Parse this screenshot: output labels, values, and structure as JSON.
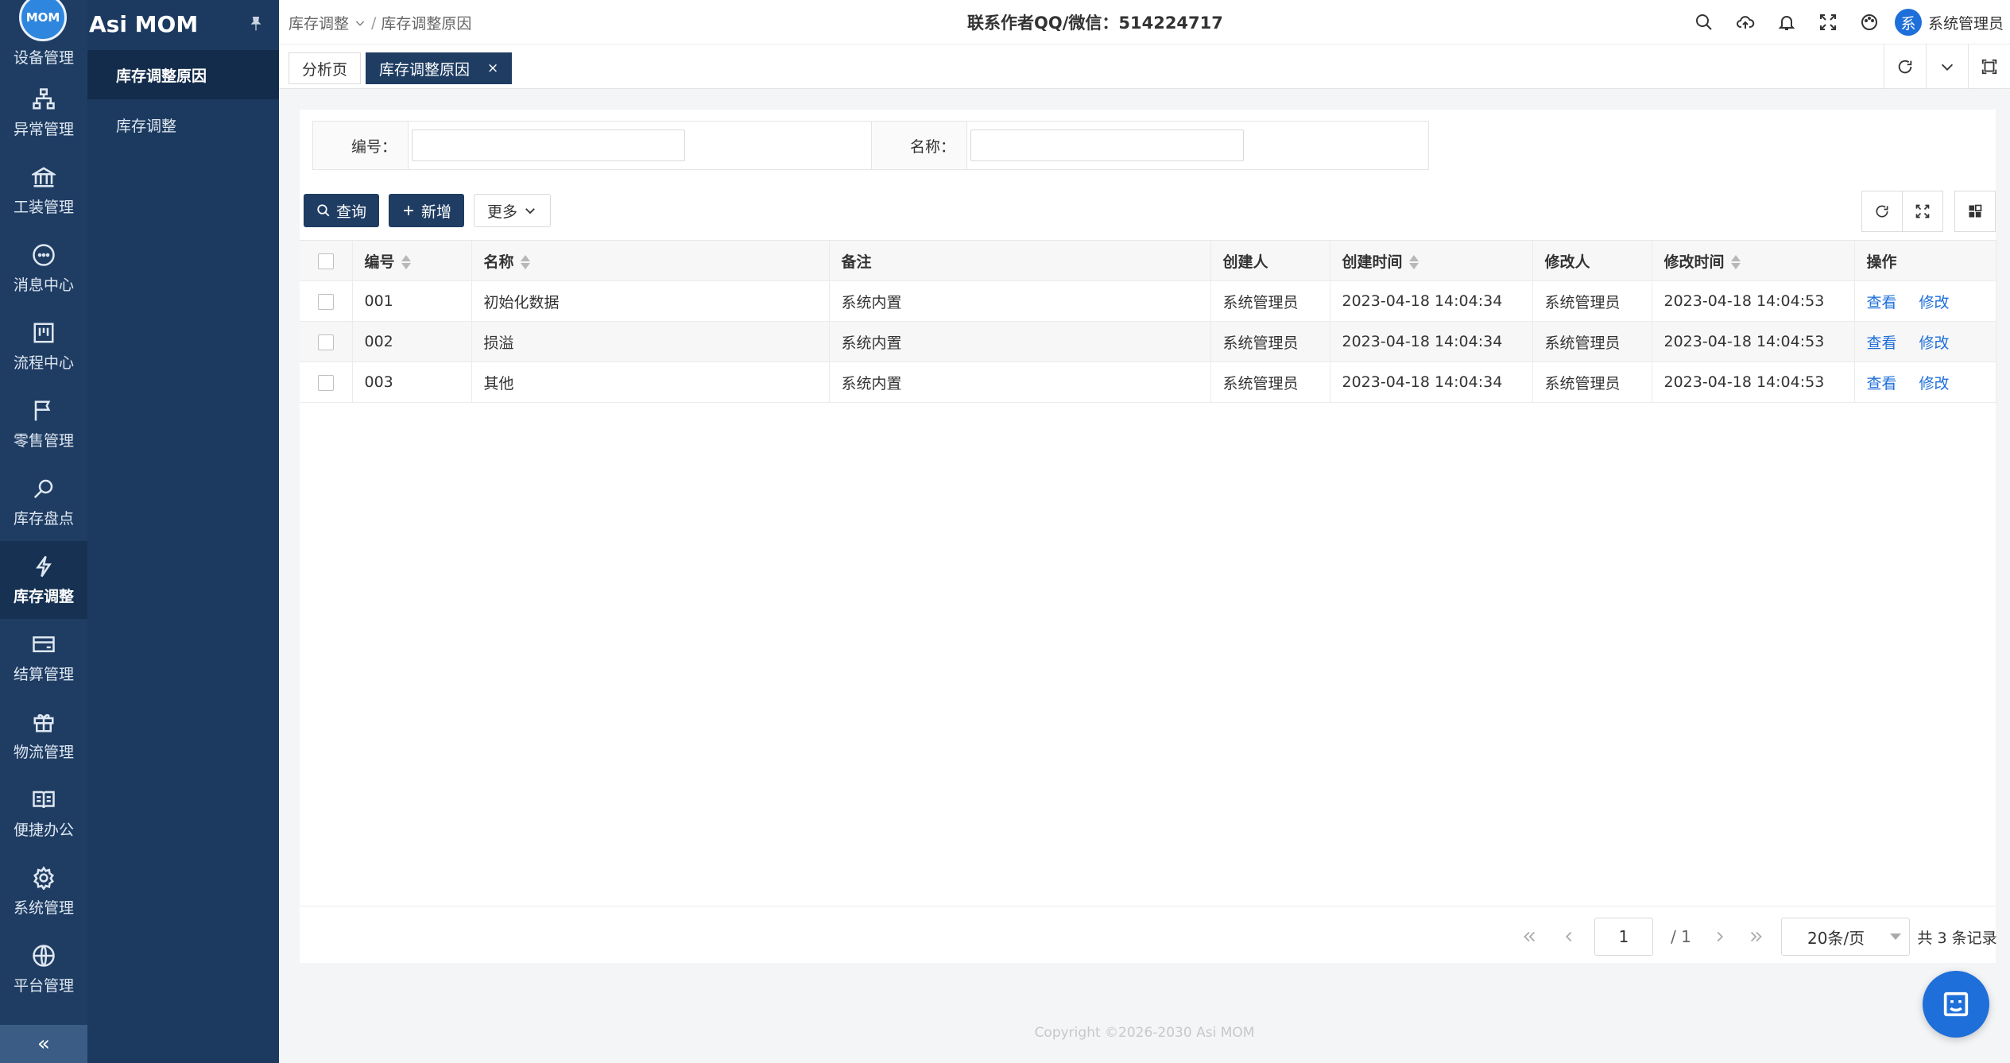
{
  "app": {
    "logo_text": "MOM",
    "name": "Asi MOM"
  },
  "rail": {
    "first_partial": "设备管理",
    "items": [
      {
        "label": "异常管理",
        "icon": "sitemap-icon"
      },
      {
        "label": "工装管理",
        "icon": "bank-icon"
      },
      {
        "label": "消息中心",
        "icon": "message-icon"
      },
      {
        "label": "流程中心",
        "icon": "board-icon"
      },
      {
        "label": "零售管理",
        "icon": "flag-icon"
      },
      {
        "label": "库存盘点",
        "icon": "search-doc-icon"
      },
      {
        "label": "库存调整",
        "icon": "bolt-icon",
        "active": true
      },
      {
        "label": "结算管理",
        "icon": "card-icon"
      },
      {
        "label": "物流管理",
        "icon": "gift-icon"
      },
      {
        "label": "便捷办公",
        "icon": "book-icon"
      },
      {
        "label": "系统管理",
        "icon": "gear-icon"
      },
      {
        "label": "平台管理",
        "icon": "globe-icon"
      }
    ],
    "collapse": "«"
  },
  "submenu": {
    "items": [
      "库存调整原因",
      "库存调整"
    ],
    "active_index": 0
  },
  "header": {
    "breadcrumb": [
      "库存调整",
      "库存调整原因"
    ],
    "contact": "联系作者QQ/微信：514224717",
    "user_avatar": "系",
    "user_name": "系统管理员"
  },
  "tabs": [
    {
      "label": "分析页",
      "active": false
    },
    {
      "label": "库存调整原因",
      "active": true,
      "close": "×"
    }
  ],
  "search": {
    "fields": [
      {
        "label": "编号：",
        "value": "",
        "placeholder": ""
      },
      {
        "label": "名称：",
        "value": "",
        "placeholder": ""
      }
    ]
  },
  "toolbar": {
    "query": "查询",
    "add": "新增",
    "more": "更多"
  },
  "table": {
    "columns": [
      "编号",
      "名称",
      "备注",
      "创建人",
      "创建时间",
      "修改人",
      "修改时间",
      "操作"
    ],
    "rows": [
      {
        "code": "001",
        "name": "初始化数据",
        "remark": "系统内置",
        "creator": "系统管理员",
        "created": "2023-04-18 14:04:34",
        "modifier": "系统管理员",
        "modified": "2023-04-18 14:04:53"
      },
      {
        "code": "002",
        "name": "损溢",
        "remark": "系统内置",
        "creator": "系统管理员",
        "created": "2023-04-18 14:04:34",
        "modifier": "系统管理员",
        "modified": "2023-04-18 14:04:53"
      },
      {
        "code": "003",
        "name": "其他",
        "remark": "系统内置",
        "creator": "系统管理员",
        "created": "2023-04-18 14:04:34",
        "modifier": "系统管理员",
        "modified": "2023-04-18 14:04:53"
      }
    ],
    "actions": [
      "查看",
      "修改"
    ]
  },
  "pager": {
    "page": "1",
    "total_pages": "/ 1",
    "page_size": "20条/页",
    "total": "共 3 条记录"
  },
  "footer": {
    "copyright": "Copyright ©2026-2030 Asi MOM"
  },
  "colors": {
    "primary": "#1f3d63",
    "link": "#1e6fd9",
    "rail": "#1f3d63"
  }
}
